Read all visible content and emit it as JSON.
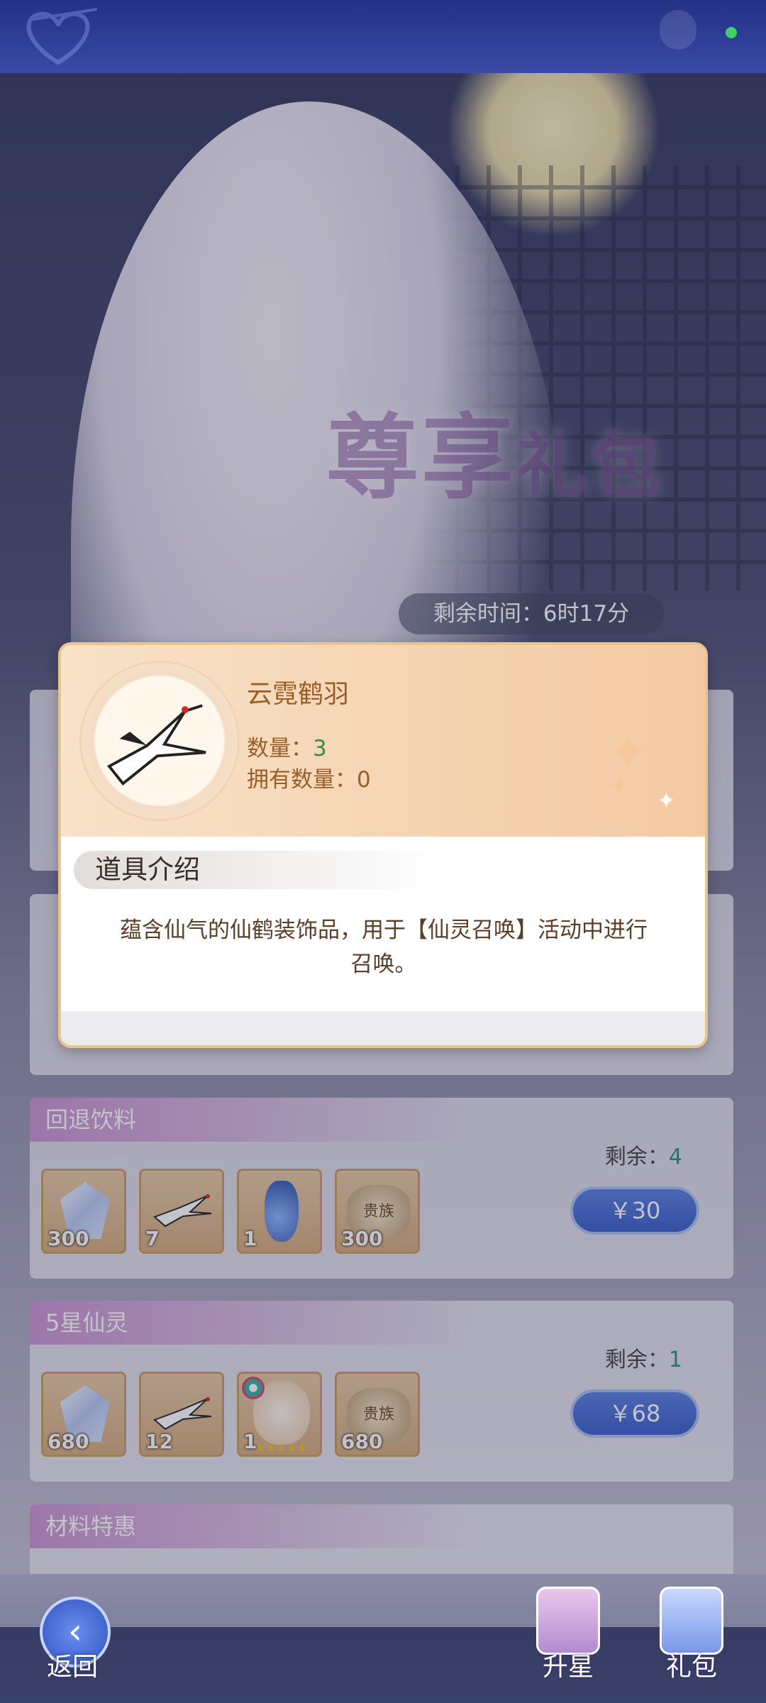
{
  "header": {
    "status_dot_color": "#3fd06a"
  },
  "banner": {
    "title_part1": "尊享",
    "title_part2": "礼包",
    "timer_label": "剩余时间：",
    "timer_value": "6时17分"
  },
  "popup": {
    "item_name": "云霓鹤羽",
    "quantity_label": "数量：",
    "quantity_value": "3",
    "owned_label": "拥有数量：",
    "owned_value": "0",
    "section_title": "道具介绍",
    "description": "蕴含仙气的仙鹤装饰品，用于【仙灵召唤】活动中进行召唤。"
  },
  "packs": [
    {
      "title": "回退饮料",
      "remain_label": "剩余：",
      "remain_value": "4",
      "price": "￥30",
      "items": [
        {
          "icon": "diamond-icon",
          "qty": "300"
        },
        {
          "icon": "crane-feather-icon",
          "qty": "7"
        },
        {
          "icon": "potion-icon",
          "qty": "1"
        },
        {
          "icon": "noble-badge-icon",
          "label": "贵族",
          "qty": "300"
        }
      ]
    },
    {
      "title": "5星仙灵",
      "remain_label": "剩余：",
      "remain_value": "1",
      "price": "￥68",
      "items": [
        {
          "icon": "diamond-icon",
          "qty": "680"
        },
        {
          "icon": "crane-feather-icon",
          "qty": "12"
        },
        {
          "icon": "fairy-sprite-icon",
          "qty": "1",
          "stars": 5
        },
        {
          "icon": "noble-badge-icon",
          "label": "贵族",
          "qty": "680"
        }
      ]
    },
    {
      "title": "材料特惠"
    }
  ],
  "nav": {
    "back": "返回",
    "upgrade": "升星",
    "gift": "礼包"
  }
}
